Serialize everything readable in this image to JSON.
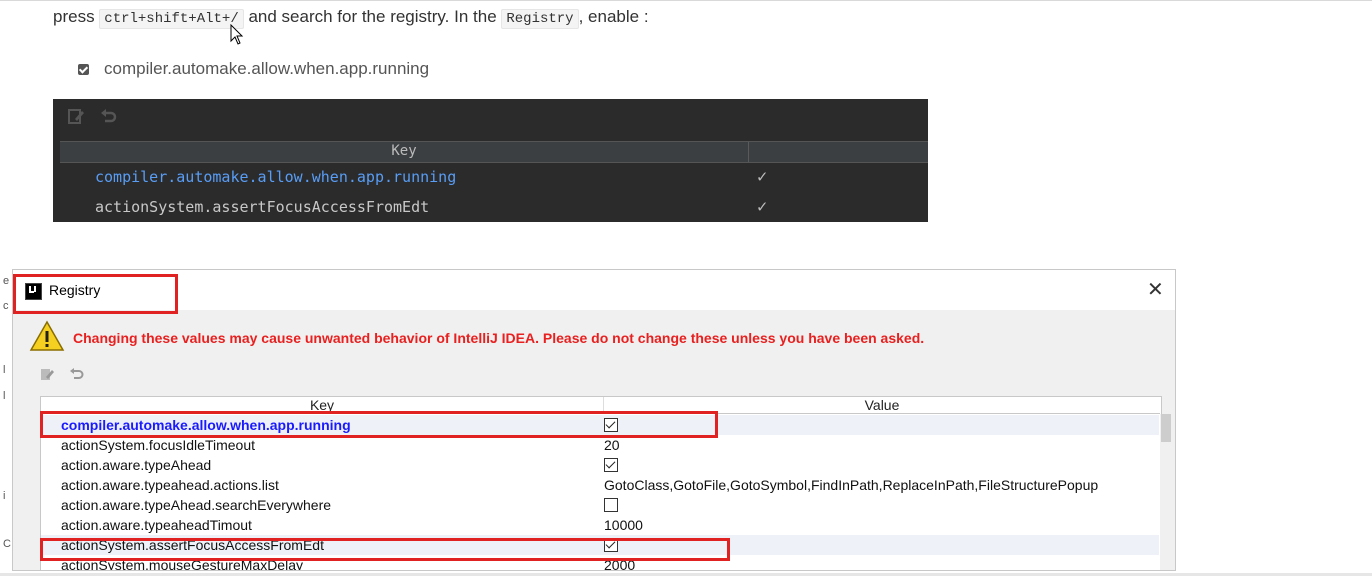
{
  "doc": {
    "intro": {
      "pre": "press ",
      "shortcut": "ctrl+shift+Alt+/",
      "mid": " and search for the registry. In the ",
      "registry_code": "Registry",
      "post": ", enable :"
    },
    "bullet": "compiler.automake.allow.when.app.running"
  },
  "dark_panel": {
    "header_key": "Key",
    "rows": [
      {
        "key": "compiler.automake.allow.when.app.running",
        "checked": true
      },
      {
        "key": "actionSystem.assertFocusAccessFromEdt",
        "checked": true
      }
    ],
    "check_glyph": "✓"
  },
  "dialog": {
    "title": "Registry",
    "close_glyph": "✕",
    "warning": "Changing these values may cause unwanted behavior of IntelliJ IDEA. Please do not change these unless you have been asked.",
    "columns": {
      "key": "Key",
      "value": "Value"
    },
    "rows": [
      {
        "key": "compiler.automake.allow.when.app.running",
        "value": "",
        "bool": true,
        "checked": true
      },
      {
        "key": "actionSystem.focusIdleTimeout",
        "value": "20",
        "bool": false
      },
      {
        "key": "action.aware.typeAhead",
        "value": "",
        "bool": true,
        "checked": true
      },
      {
        "key": "action.aware.typeahead.actions.list",
        "value": "GotoClass,GotoFile,GotoSymbol,FindInPath,ReplaceInPath,FileStructurePopup",
        "bool": false
      },
      {
        "key": "action.aware.typeAhead.searchEverywhere",
        "value": "",
        "bool": true,
        "checked": false
      },
      {
        "key": "action.aware.typeaheadTimout",
        "value": "10000",
        "bool": false
      },
      {
        "key": "actionSystem.assertFocusAccessFromEdt",
        "value": "",
        "bool": true,
        "checked": true
      },
      {
        "key": "actionSystem.mouseGestureMaxDelay",
        "value": "2000",
        "bool": false
      }
    ]
  },
  "colors": {
    "highlight_red": "#e02222",
    "warning_red": "#e8201f",
    "link_blue": "#1a1aff",
    "dark_bg": "#2b2b2b",
    "dark_blue_text": "#589df6"
  }
}
